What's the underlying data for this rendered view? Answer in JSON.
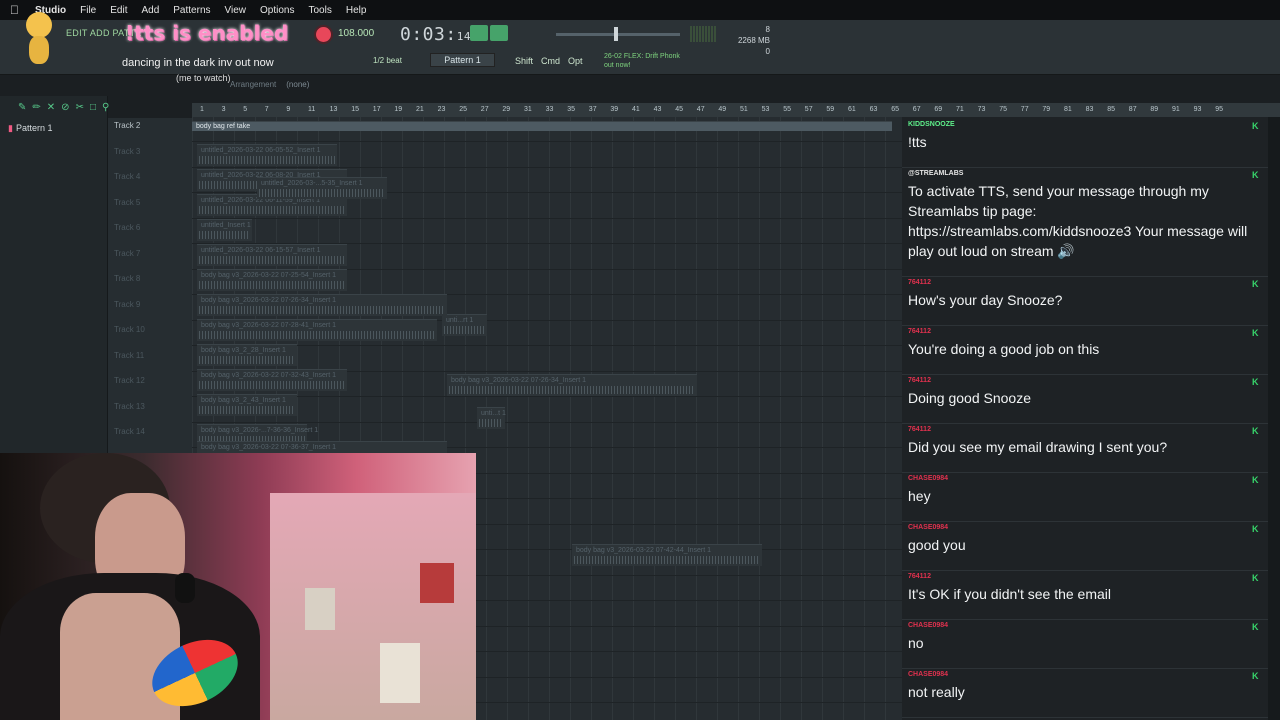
{
  "menubar": {
    "app_name": "Studio",
    "items": [
      "File",
      "Edit",
      "Add",
      "Patterns",
      "View",
      "Options",
      "Tools",
      "Help"
    ]
  },
  "overlay": {
    "tts_banner": "!tts is enabled",
    "now_playing": "dancing in the dark inv out now",
    "me_to_watch": "(me to watch)"
  },
  "toolbar": {
    "edit_add_label": "EDIT ADD PATTE",
    "tempo": "108.000",
    "time_main": "0:03",
    "time_frac": "14",
    "cpu_mem": "2268 MB",
    "cpu_num": "8",
    "cpu_zero": "0",
    "snap": "1/2 beat",
    "pattern": "Pattern 1",
    "mods": [
      "Shift",
      "Cmd",
      "Opt"
    ],
    "flex_news_1": "26-02 FLEX: Drift Phonk",
    "flex_news_2": "out now!",
    "arrangement": "Arrangement",
    "arrangement_value": "(none)"
  },
  "playlist": {
    "pattern_item": "Pattern 1",
    "track_labels": [
      "Track 2",
      "Track 3",
      "Track 4",
      "Track 5",
      "Track 6",
      "Track 7",
      "Track 8",
      "Track 9",
      "Track 10",
      "Track 11",
      "Track 12",
      "Track 13",
      "Track 14"
    ],
    "ruler": [
      "1",
      "3",
      "5",
      "7",
      "9",
      "11",
      "13",
      "15",
      "17",
      "19",
      "21",
      "23",
      "25",
      "27",
      "29",
      "31",
      "33",
      "35",
      "37",
      "39",
      "41",
      "43",
      "45",
      "47",
      "49",
      "51",
      "53",
      "55",
      "57",
      "59",
      "61",
      "63",
      "65",
      "67",
      "69",
      "71",
      "73",
      "75",
      "77",
      "79",
      "81",
      "83",
      "85",
      "87",
      "89",
      "91",
      "93",
      "95"
    ],
    "clips": [
      {
        "label": "body bag ref take"
      },
      {
        "label": "untitled_2026-03-22 06-05-52_Insert 1"
      },
      {
        "label": "untitled_2026-03-22 06-08-20_Insert 1"
      },
      {
        "label": "untitled_2026-03-22 06-11-59_Insert 1"
      },
      {
        "label": "untitled_Insert 1"
      },
      {
        "label": "untitled_2026-03-...5-35_Insert 1"
      },
      {
        "label": "unti...t 1"
      },
      {
        "label": "untitled_2026-03-22 06-15-57_Insert 1"
      },
      {
        "label": "unti...rt 1"
      },
      {
        "label": "body bag v3_2026-03-22 07-25-54_Insert 1"
      },
      {
        "label": "body bag v3_2026-03-22 07-26-34_Insert 1"
      },
      {
        "label": "body bag v3_2026-03-22 07-26-34_Insert 1"
      },
      {
        "label": "body bag v3_2026-03-22 07-28-41_Insert 1"
      },
      {
        "label": "body bag v3_2_28_Insert 1"
      },
      {
        "label": "body bag v3_2026-03-22 07-32-43_Insert 1"
      },
      {
        "label": "body bag v3_2_43_Insert 1"
      },
      {
        "label": "body bag v3_2026-...7-36-36_Insert 1"
      },
      {
        "label": "body bag v3_2026-03-22 07-36-37_Insert 1"
      },
      {
        "label": "body bag v3_2026-03-22 07-42-44_Insert 1"
      }
    ]
  },
  "chat": {
    "messages": [
      {
        "user": "KIDDSNOOZE",
        "color": "#5ef08a",
        "text": "!tts"
      },
      {
        "user": "@STREAMLABS",
        "color": "#e5e5e5",
        "text": "To activate TTS, send your message through my Streamlabs tip page: https://streamlabs.com/kiddsnooze3 Your message will play out loud on stream 🔊"
      },
      {
        "user": "764112",
        "color": "#e0314e",
        "text": "How's your day Snooze?"
      },
      {
        "user": "764112",
        "color": "#e0314e",
        "text": "You're doing a good job on this"
      },
      {
        "user": "764112",
        "color": "#e0314e",
        "text": "Doing good Snooze"
      },
      {
        "user": "764112",
        "color": "#e0314e",
        "text": "Did you see my email drawing I sent you?"
      },
      {
        "user": "CHASE0984",
        "color": "#e0314e",
        "text": "hey"
      },
      {
        "user": "CHASE0984",
        "color": "#e0314e",
        "text": "good you"
      },
      {
        "user": "764112",
        "color": "#e0314e",
        "text": "It's OK if you didn't see the email"
      },
      {
        "user": "CHASE0984",
        "color": "#e0314e",
        "text": "no"
      },
      {
        "user": "CHASE0984",
        "color": "#e0314e",
        "text": "not really"
      }
    ]
  }
}
